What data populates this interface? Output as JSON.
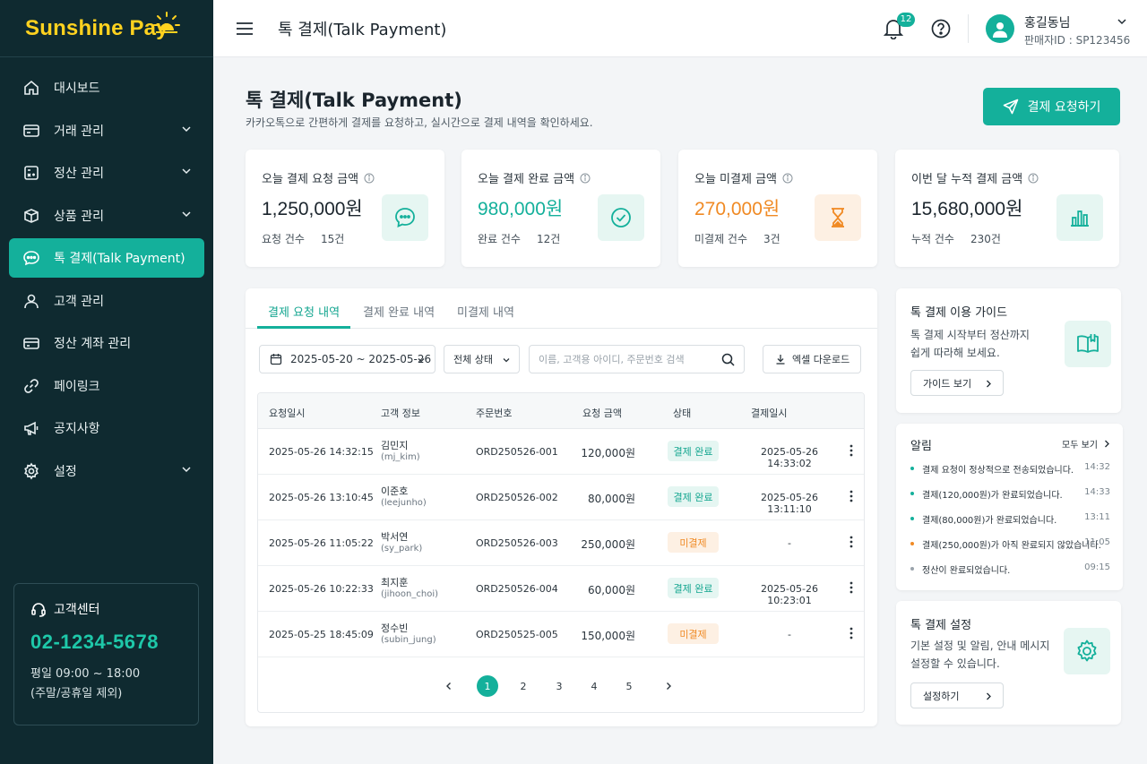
{
  "app": {
    "brand": "Sunshine Pay"
  },
  "sidebar": {
    "items": [
      {
        "label": "대시보드",
        "icon": "home-icon",
        "expandable": false
      },
      {
        "label": "거래 관리",
        "icon": "card-icon",
        "expandable": true
      },
      {
        "label": "정산 관리",
        "icon": "calculator-icon",
        "expandable": true
      },
      {
        "label": "상품 관리",
        "icon": "box-icon",
        "expandable": true
      },
      {
        "label": "톡 결제(Talk Payment)",
        "icon": "chat-icon",
        "expandable": false,
        "active": true
      },
      {
        "label": "고객 관리",
        "icon": "user-icon",
        "expandable": false
      },
      {
        "label": "정산 계좌 관리",
        "icon": "wallet-icon",
        "expandable": false
      },
      {
        "label": "페이링크",
        "icon": "link-icon",
        "expandable": false
      },
      {
        "label": "공지사항",
        "icon": "megaphone-icon",
        "expandable": false
      },
      {
        "label": "설정",
        "icon": "gear-icon",
        "expandable": true
      }
    ],
    "support": {
      "title": "고객센터",
      "phone": "02-1234-5678",
      "hours": "평일 09:00 ~ 18:00",
      "note": "(주말/공휴일 제외)"
    }
  },
  "topbar": {
    "title": "톡 결제(Talk Payment)",
    "notification_count": "12",
    "user_name": "홍길동님",
    "seller_id": "판매자ID : SP123456"
  },
  "page": {
    "title": "톡 결제(Talk Payment)",
    "subtitle": "카카오톡으로 간편하게 결제를 요청하고, 실시간으로 결제 내역을 확인하세요.",
    "request_button": "결제 요청하기"
  },
  "stats": [
    {
      "label": "오늘 결제 요청 금액",
      "value": "1,250,000원",
      "count_label": "요청 건수",
      "count": "15건",
      "color": "#1b252d",
      "icon": "chat-icon",
      "icon_bg": "#e6f6f2",
      "icon_color": "#14b09b"
    },
    {
      "label": "오늘 결제 완료 금액",
      "value": "980,000원",
      "count_label": "완료 건수",
      "count": "12건",
      "color": "#14b09b",
      "icon": "check-circle-icon",
      "icon_bg": "#e6f6f2",
      "icon_color": "#14b09b"
    },
    {
      "label": "오늘 미결제 금액",
      "value": "270,000원",
      "count_label": "미결제 건수",
      "count": "3건",
      "color": "#f08a24",
      "icon": "hourglass-icon",
      "icon_bg": "#fdf0e3",
      "icon_color": "#f08a24"
    },
    {
      "label": "이번 달 누적 결제 금액",
      "value": "15,680,000원",
      "count_label": "누적 건수",
      "count": "230건",
      "color": "#1b252d",
      "icon": "bar-chart-icon",
      "icon_bg": "#e6f6f2",
      "icon_color": "#14b09b"
    }
  ],
  "tabs": [
    {
      "label": "결제 요청 내역",
      "active": true
    },
    {
      "label": "결제 완료 내역",
      "active": false
    },
    {
      "label": "미결제 내역",
      "active": false
    }
  ],
  "filters": {
    "date_range": "2025-05-20 ~ 2025-05-26",
    "status": "전체 상태",
    "search_placeholder": "이름, 고객용 아이디, 주문번호 검색",
    "excel_button": "엑셀 다운로드"
  },
  "table": {
    "headers": [
      "요청일시",
      "고객 정보",
      "주문번호",
      "요청 금액",
      "상태",
      "결제일시"
    ],
    "rows": [
      {
        "requested": "2025-05-26 14:32:15",
        "name": "김민지",
        "uid": "(mj_kim)",
        "order": "ORD250526-001",
        "amount": "120,000원",
        "status": "결제 완료",
        "status_type": "done",
        "paid": "2025-05-26 14:33:02"
      },
      {
        "requested": "2025-05-26 13:10:45",
        "name": "이준호",
        "uid": "(leejunho)",
        "order": "ORD250526-002",
        "amount": "80,000원",
        "status": "결제 완료",
        "status_type": "done",
        "paid": "2025-05-26 13:11:10"
      },
      {
        "requested": "2025-05-26 11:05:22",
        "name": "박서연",
        "uid": "(sy_park)",
        "order": "ORD250526-003",
        "amount": "250,000원",
        "status": "미결제",
        "status_type": "pending",
        "paid": "-"
      },
      {
        "requested": "2025-05-26 10:22:33",
        "name": "최지훈",
        "uid": "(jihoon_choi)",
        "order": "ORD250526-004",
        "amount": "60,000원",
        "status": "결제 완료",
        "status_type": "done",
        "paid": "2025-05-26 10:23:01"
      },
      {
        "requested": "2025-05-25 18:45:09",
        "name": "정수빈",
        "uid": "(subin_jung)",
        "order": "ORD250525-005",
        "amount": "150,000원",
        "status": "미결제",
        "status_type": "pending",
        "paid": "-"
      }
    ]
  },
  "pagination": {
    "pages": [
      "1",
      "2",
      "3",
      "4",
      "5"
    ],
    "current": "1"
  },
  "guide": {
    "title": "톡 결제 이용 가이드",
    "line1": "톡 결제 시작부터 정산까지",
    "line2": "쉽게 따라해 보세요.",
    "button": "가이드 보기"
  },
  "alerts": {
    "title": "알림",
    "view_all": "모두 보기",
    "items": [
      {
        "text": "결제 요청이 정상적으로 전송되었습니다.",
        "time": "14:32",
        "color": "#14b09b"
      },
      {
        "text": "결제(120,000원)가 완료되었습니다.",
        "time": "14:33",
        "color": "#14b09b"
      },
      {
        "text": "결제(80,000원)가 완료되었습니다.",
        "time": "13:11",
        "color": "#14b09b"
      },
      {
        "text": "결제(250,000원)가 아직 완료되지 않았습니다.",
        "time": "11:05",
        "color": "#f08a24"
      },
      {
        "text": "정산이 완료되었습니다.",
        "time": "09:15",
        "color": "#9aa3ab"
      }
    ]
  },
  "settings": {
    "title": "톡 결제 설정",
    "line1": "기본 설정 및 알림, 안내 메시지",
    "line2": "설정할 수 있습니다.",
    "button": "설정하기"
  }
}
